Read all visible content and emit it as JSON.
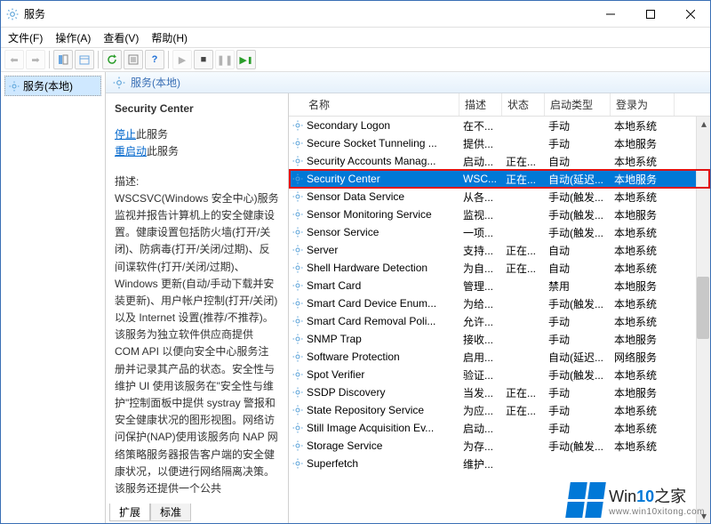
{
  "title": "服务",
  "menubar": [
    "文件(F)",
    "操作(A)",
    "查看(V)",
    "帮助(H)"
  ],
  "tree_root": "服务(本地)",
  "pane_header": "服务(本地)",
  "detail": {
    "title": "Security Center",
    "stop_label": "停止",
    "stop_suffix": "此服务",
    "restart_label": "重启动",
    "restart_suffix": "此服务",
    "desc_label": "描述:",
    "desc_text": "WSCSVC(Windows 安全中心)服务监视并报告计算机上的安全健康设置。健康设置包括防火墙(打开/关闭)、防病毒(打开/关闭/过期)、反间谍软件(打开/关闭/过期)、Windows 更新(自动/手动下载并安装更新)、用户帐户控制(打开/关闭)以及 Internet 设置(推荐/不推荐)。该服务为独立软件供应商提供 COM API 以便向安全中心服务注册并记录其产品的状态。安全性与维护 UI 使用该服务在\"安全性与维护\"控制面板中提供 systray 警报和安全健康状况的图形视图。网络访问保护(NAP)使用该服务向 NAP 网络策略服务器报告客户端的安全健康状况，以便进行网络隔离决策。该服务还提供一个公共"
  },
  "tabs": {
    "extended": "扩展",
    "standard": "标准"
  },
  "columns": {
    "name": "名称",
    "desc": "描述",
    "status": "状态",
    "startup": "启动类型",
    "logon": "登录为"
  },
  "rows": [
    {
      "name": "Secondary Logon",
      "desc": "在不...",
      "status": "",
      "startup": "手动",
      "logon": "本地系统",
      "selected": false
    },
    {
      "name": "Secure Socket Tunneling ...",
      "desc": "提供...",
      "status": "",
      "startup": "手动",
      "logon": "本地服务",
      "selected": false
    },
    {
      "name": "Security Accounts Manag...",
      "desc": "启动...",
      "status": "正在...",
      "startup": "自动",
      "logon": "本地系统",
      "selected": false
    },
    {
      "name": "Security Center",
      "desc": "WSC...",
      "status": "正在...",
      "startup": "自动(延迟...",
      "logon": "本地服务",
      "selected": true
    },
    {
      "name": "Sensor Data Service",
      "desc": "从各...",
      "status": "",
      "startup": "手动(触发...",
      "logon": "本地系统",
      "selected": false
    },
    {
      "name": "Sensor Monitoring Service",
      "desc": "监视...",
      "status": "",
      "startup": "手动(触发...",
      "logon": "本地服务",
      "selected": false
    },
    {
      "name": "Sensor Service",
      "desc": "一项...",
      "status": "",
      "startup": "手动(触发...",
      "logon": "本地系统",
      "selected": false
    },
    {
      "name": "Server",
      "desc": "支持...",
      "status": "正在...",
      "startup": "自动",
      "logon": "本地系统",
      "selected": false
    },
    {
      "name": "Shell Hardware Detection",
      "desc": "为自...",
      "status": "正在...",
      "startup": "自动",
      "logon": "本地系统",
      "selected": false
    },
    {
      "name": "Smart Card",
      "desc": "管理...",
      "status": "",
      "startup": "禁用",
      "logon": "本地服务",
      "selected": false
    },
    {
      "name": "Smart Card Device Enum...",
      "desc": "为给...",
      "status": "",
      "startup": "手动(触发...",
      "logon": "本地系统",
      "selected": false
    },
    {
      "name": "Smart Card Removal Poli...",
      "desc": "允许...",
      "status": "",
      "startup": "手动",
      "logon": "本地系统",
      "selected": false
    },
    {
      "name": "SNMP Trap",
      "desc": "接收...",
      "status": "",
      "startup": "手动",
      "logon": "本地服务",
      "selected": false
    },
    {
      "name": "Software Protection",
      "desc": "启用...",
      "status": "",
      "startup": "自动(延迟...",
      "logon": "网络服务",
      "selected": false
    },
    {
      "name": "Spot Verifier",
      "desc": "验证...",
      "status": "",
      "startup": "手动(触发...",
      "logon": "本地系统",
      "selected": false
    },
    {
      "name": "SSDP Discovery",
      "desc": "当发...",
      "status": "正在...",
      "startup": "手动",
      "logon": "本地服务",
      "selected": false
    },
    {
      "name": "State Repository Service",
      "desc": "为应...",
      "status": "正在...",
      "startup": "手动",
      "logon": "本地系统",
      "selected": false
    },
    {
      "name": "Still Image Acquisition Ev...",
      "desc": "启动...",
      "status": "",
      "startup": "手动",
      "logon": "本地系统",
      "selected": false
    },
    {
      "name": "Storage Service",
      "desc": "为存...",
      "status": "",
      "startup": "手动(触发...",
      "logon": "本地系统",
      "selected": false
    },
    {
      "name": "Superfetch",
      "desc": "维护...",
      "status": "",
      "startup": "",
      "logon": "",
      "selected": false
    }
  ],
  "watermark": {
    "brand_prefix": "Win",
    "brand_num": "10",
    "brand_suffix": "之家",
    "url": "www.win10xitong.com"
  }
}
